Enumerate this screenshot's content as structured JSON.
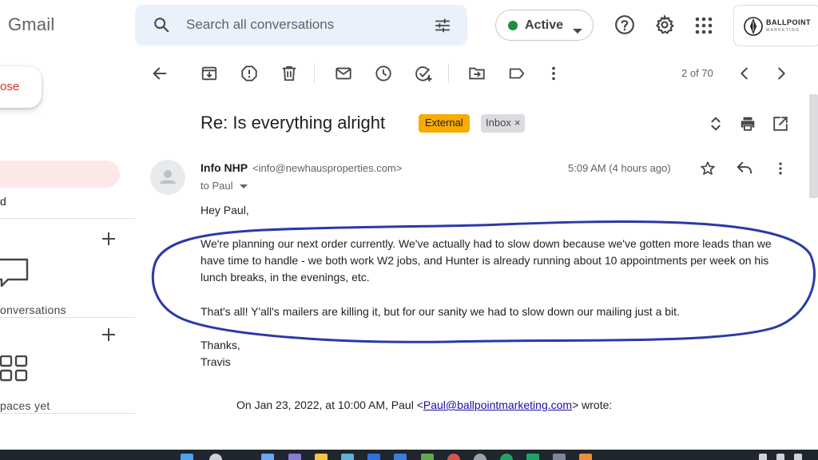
{
  "app": {
    "logo_text": "Gmail"
  },
  "search": {
    "placeholder": "Search all conversations"
  },
  "status": {
    "label": "Active",
    "color": "#1e8e3e"
  },
  "brand": {
    "name": "BALLPOINT",
    "sub": "MARKETING"
  },
  "sidebar": {
    "compose_label": "ose",
    "truncated_label": "d",
    "conversations_label": "onversations",
    "spaces_label": "paces yet"
  },
  "toolbar": {
    "icons": [
      "back-arrow-icon",
      "archive-icon",
      "report-spam-icon",
      "delete-icon",
      "mark-unread-icon",
      "snooze-icon",
      "add-to-tasks-icon",
      "move-to-icon",
      "label-icon",
      "more-vert-icon"
    ],
    "pager": "2 of 70"
  },
  "email": {
    "subject": "Re: Is everything alright",
    "tag_external": "External",
    "tag_inbox": "Inbox",
    "tag_close": "×",
    "sender_name": "Info NHP",
    "sender_email": "<info@newhausproperties.com>",
    "to": "to Paul",
    "time": "5:09 AM (4 hours ago)",
    "greeting": "Hey Paul,",
    "para1": "We're planning our next order currently. We've actually had to slow down because we've gotten more leads than we have time to handle - we both work W2 jobs, and Hunter is already running about 10 appointments per week on his lunch breaks, in the evenings, etc.",
    "para2": "That's all! Y'all's mailers are killing it, but for our sanity we had to slow down our mailing just a bit.",
    "signoff": "Thanks,",
    "signature": "Travis",
    "quote_prefix": "On Jan 23, 2022, at 10:00 AM, Paul <",
    "quote_link": "Paul@ballpointmarketing.com",
    "quote_suffix": "> wrote:"
  },
  "colors": {
    "accent_red": "#d93025",
    "tag_external": "#f9ab00",
    "annotation_circle": "#2a3aa8",
    "taskbar": "#20262d"
  }
}
